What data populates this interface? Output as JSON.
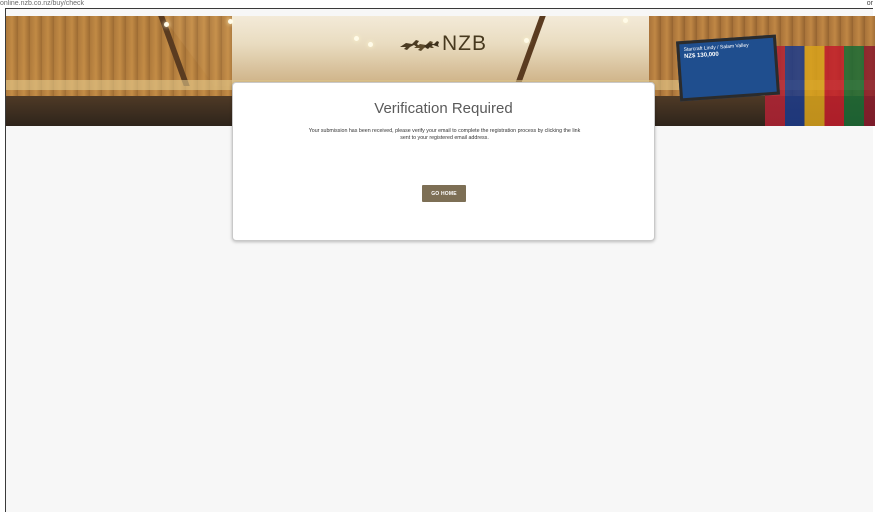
{
  "browser": {
    "url": "online.nzb.co.nz/buy/check",
    "corner_text": "or"
  },
  "header": {
    "logo_text": "NZB",
    "logo_icon": "horses-icon",
    "board": {
      "line1": "Starcraft Lindy / Salam Valley",
      "line2": "NZ$ 130,000"
    }
  },
  "card": {
    "title": "Verification Required",
    "message": "Your submission has been received, please verify your email to complete the registration process by clicking the link sent to your registered email address.",
    "button_label": "GO HOME"
  },
  "colors": {
    "button": "#7d6f55",
    "title": "#5a5a5a",
    "logo": "#47391f"
  }
}
